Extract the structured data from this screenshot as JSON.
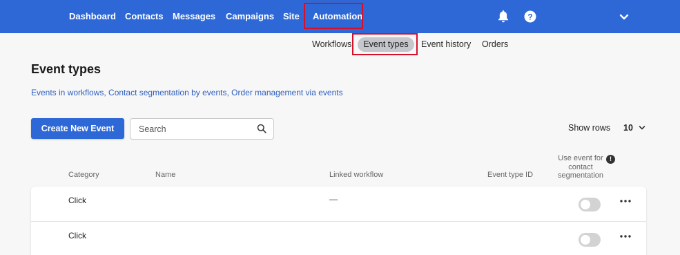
{
  "header": {
    "nav": [
      {
        "label": "Dashboard"
      },
      {
        "label": "Contacts"
      },
      {
        "label": "Messages"
      },
      {
        "label": "Campaigns"
      },
      {
        "label": "Site"
      },
      {
        "label": "Automation"
      }
    ],
    "active_nav": "Automation",
    "icons": [
      "bell-icon",
      "help-icon",
      "chevron-down-icon"
    ],
    "brand_color": "#2d68d6",
    "highlight_color": "#d7102a"
  },
  "subnav": {
    "items": [
      {
        "label": "Workflows"
      },
      {
        "label": "Event types"
      },
      {
        "label": "Event history"
      },
      {
        "label": "Orders"
      }
    ],
    "active": "Event types"
  },
  "page": {
    "title": "Event types",
    "links": [
      {
        "label": "Events in workflows"
      },
      {
        "label": "Contact segmentation by events"
      },
      {
        "label": "Order management via events"
      }
    ],
    "link_separator": ", "
  },
  "toolbar": {
    "create_label": "Create New Event",
    "search_placeholder": "Search",
    "search_value": "",
    "show_rows_label": "Show rows",
    "show_rows_value": "10"
  },
  "table": {
    "columns": {
      "category": "Category",
      "name": "Name",
      "linked_workflow": "Linked workflow",
      "event_type_id": "Event type ID",
      "segmentation": "Use event for contact segmentation"
    },
    "rows": [
      {
        "category": "Click",
        "name": "",
        "linked_workflow": "—",
        "event_type_id": "",
        "segmentation": false
      },
      {
        "category": "Click",
        "name": "",
        "linked_workflow": "",
        "event_type_id": "",
        "segmentation": false
      }
    ]
  }
}
